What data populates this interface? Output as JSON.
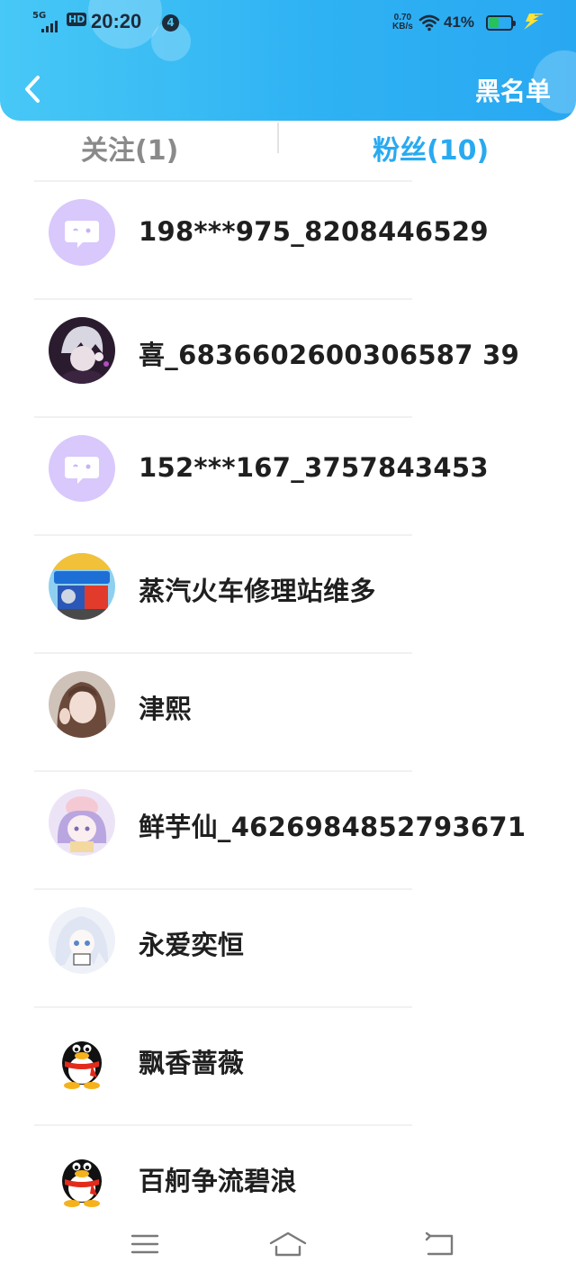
{
  "status_bar": {
    "network": "5G",
    "hd": "HD",
    "time": "20:20",
    "notification_count": "4",
    "speed_value": "0.70",
    "speed_unit": "KB/s",
    "battery_percent": "41%",
    "battery_level": 0.45,
    "battery_color": "#27c25a"
  },
  "header": {
    "back_icon": "chevron-left-icon",
    "blacklist_label": "黑名单",
    "gradient": [
      "#47c8f6",
      "#29a8f2"
    ]
  },
  "tabs": {
    "follow": "关注(1)",
    "fans": "粉丝(10)",
    "active": "fans",
    "active_color": "#29aaf0",
    "inactive_color": "#8a8a8a"
  },
  "fans": [
    {
      "name": "198***975_8208446529",
      "avatar": "default-chat-bubble"
    },
    {
      "name": "喜_6836602600306587 39",
      "avatar": "anime-dark-character"
    },
    {
      "name": "152***167_3757843453",
      "avatar": "default-chat-bubble"
    },
    {
      "name": "蒸汽火车修理站维多",
      "avatar": "cartoon-train-poster"
    },
    {
      "name": "津熙",
      "avatar": "girl-photo"
    },
    {
      "name": "鲜芋仙_4626984852793671",
      "avatar": "pastel-anime-character"
    },
    {
      "name": "永爱奕恒",
      "avatar": "white-hair-anime-character"
    },
    {
      "name": "飘香蔷薇",
      "avatar": "qq-penguin"
    },
    {
      "name": "百舸争流碧浪",
      "avatar": "qq-penguin"
    }
  ],
  "nav_bar": {
    "menu_icon": "menu-icon",
    "home_icon": "home-icon",
    "back_icon": "return-icon"
  }
}
